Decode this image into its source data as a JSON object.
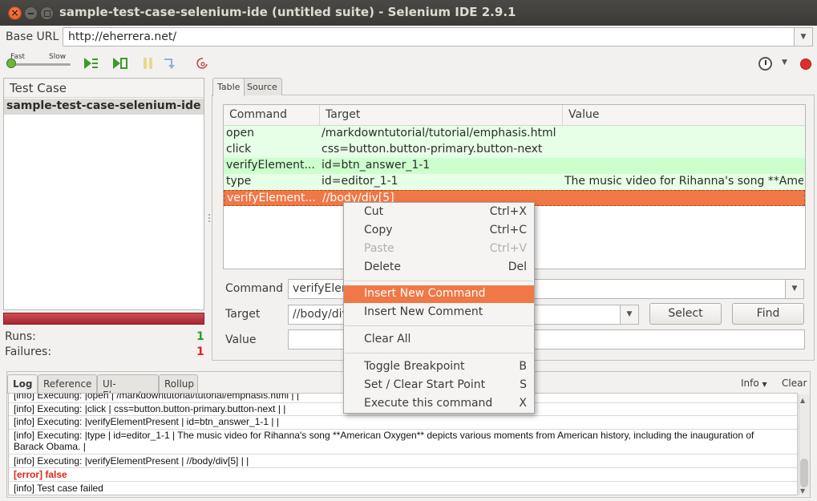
{
  "window": {
    "title": "sample-test-case-selenium-ide (untitled suite) - Selenium IDE 2.9.1",
    "close_glyph": "×"
  },
  "base_url": {
    "label": "Base URL",
    "value": "http://eherrera.net/"
  },
  "toolbar": {
    "speed_fast": "Fast",
    "speed_slow": "Slow",
    "icons": [
      "play-suite-icon",
      "play-test-icon",
      "pause-icon",
      "step-icon",
      "rollup-icon",
      "schedule-clock-icon",
      "record-icon"
    ]
  },
  "test_case_panel": {
    "header": "Test Case",
    "items": [
      "sample-test-case-selenium-ide"
    ],
    "runs_label": "Runs:",
    "runs_value": "1",
    "failures_label": "Failures:",
    "failures_value": "1"
  },
  "editor": {
    "tabs": [
      "Table",
      "Source"
    ],
    "columns": [
      "Command",
      "Target",
      "Value"
    ],
    "rows": [
      {
        "command": "open",
        "target": "/markdowntutorial/tutorial/emphasis.html",
        "value": ""
      },
      {
        "command": "click",
        "target": "css=button.button-primary.button-next",
        "value": ""
      },
      {
        "command": "verifyElement...",
        "target": "id=btn_answer_1-1",
        "value": ""
      },
      {
        "command": "type",
        "target": "id=editor_1-1",
        "value": "The music video for Rihanna's song **Ame..."
      },
      {
        "command": "verifyElement...",
        "target": "//body/div[5]",
        "value": ""
      }
    ],
    "command_label": "Command",
    "command_value": "verifyElementPresent",
    "target_label": "Target",
    "target_value": "//body/div[5]",
    "value_label": "Value",
    "value_value": "",
    "select_button": "Select",
    "find_button": "Find"
  },
  "context_menu": {
    "items": [
      {
        "label": "Cut",
        "shortcut": "Ctrl+X"
      },
      {
        "label": "Copy",
        "shortcut": "Ctrl+C"
      },
      {
        "label": "Paste",
        "shortcut": "Ctrl+V"
      },
      {
        "label": "Delete",
        "shortcut": "Del"
      },
      {
        "label": "Insert New Command",
        "shortcut": ""
      },
      {
        "label": "Insert New Comment",
        "shortcut": ""
      },
      {
        "label": "Clear All",
        "shortcut": ""
      },
      {
        "label": "Toggle Breakpoint",
        "shortcut": "B"
      },
      {
        "label": "Set / Clear Start Point",
        "shortcut": "S"
      },
      {
        "label": "Execute this command",
        "shortcut": "X"
      }
    ]
  },
  "log_panel": {
    "tabs": [
      "Log",
      "Reference",
      "UI-Element",
      "Rollup"
    ],
    "info_label": "Info",
    "clear_label": "Clear",
    "lines": [
      "[info] Executing: |open | /markdowntutorial/tutorial/emphasis.html | |",
      "[info] Executing: |click | css=button.button-primary.button-next | |",
      "[info] Executing: |verifyElementPresent | id=btn_answer_1-1 | |",
      "[info] Executing: |type | id=editor_1-1 | The music video for Rihanna's song **American Oxygen** depicts various moments from American history, including the inauguration of Barack Obama. |",
      "[info] Executing: |verifyElementPresent | //body/div[5] | |",
      "[error] false",
      "[info] Test case failed"
    ]
  },
  "colors": {
    "selection_accent": "#f07746",
    "pass_row": "#e7ffe6",
    "pass_row_strong": "#ccffcc",
    "error_text": "#e0241a",
    "runs_ok": "#2e9d22"
  }
}
